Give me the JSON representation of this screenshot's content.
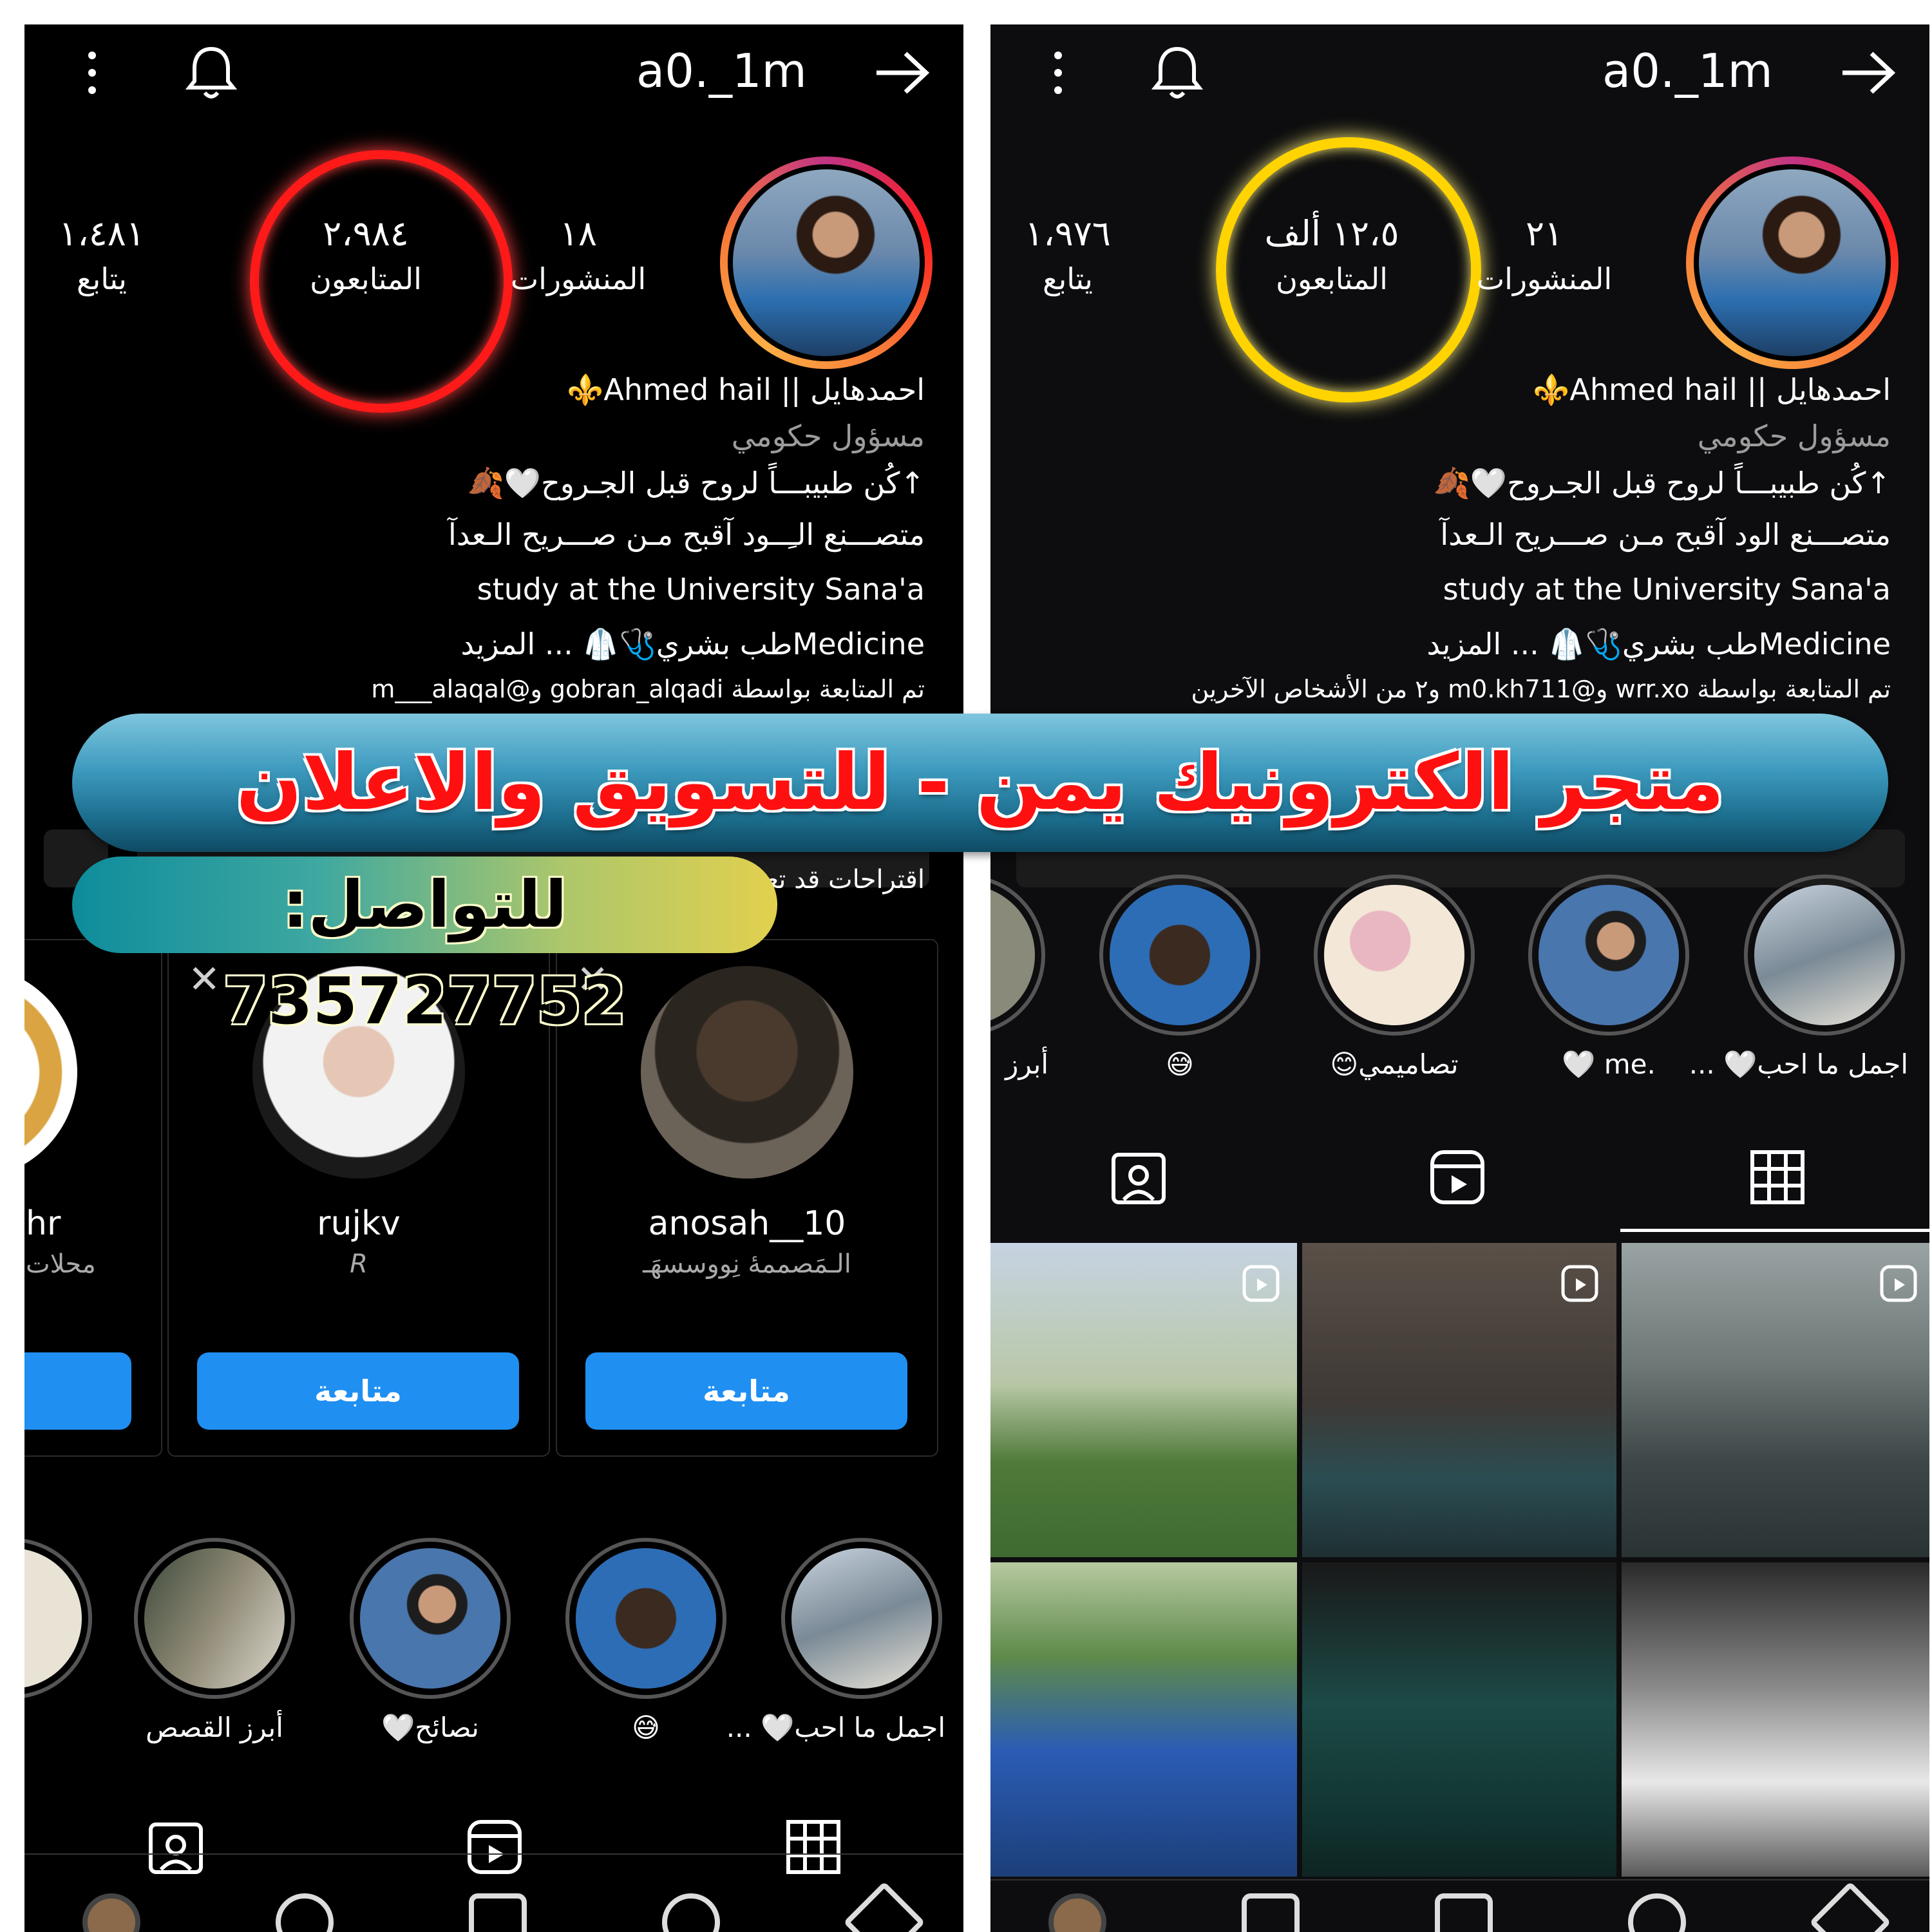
{
  "left": {
    "username": "a0._1m",
    "stats": {
      "posts": {
        "value": "١٨",
        "label": "المنشورات"
      },
      "followers": {
        "value": "٢،٩٨٤",
        "label": "المتابعون"
      },
      "following": {
        "value": "١،٤٨١",
        "label": "يتابع"
      }
    },
    "bio": {
      "name": "احمدهايل || Ahmed hail⚜️",
      "category": "مسؤول حكومي",
      "line1": "↑كُن طبيبـــاً لروح قبل الجـروح🤍🍂",
      "line2": "متصـــنع الـِــود آقبح مـن صـــريح الـعدآ",
      "line3": "study at the University Sana'a",
      "line4": "Medicineطب بشري🩺🥼 ... المزيد",
      "followed_by": "تم المتابعة بواسطة gobran_alqadi و@m___alaqal"
    },
    "suggestions_label": "اقتراحات قد تعجبك",
    "suggestions": [
      {
        "name": "anosah__10",
        "sub": "الـمَصممهٔ نِووسسهَـ",
        "button": "متابعة"
      },
      {
        "name": "rujkv",
        "sub": "R",
        "button": "متابعة"
      },
      {
        "name": "hr",
        "sub": "محلات",
        "button": ""
      }
    ],
    "stories": [
      {
        "label": "اجمل ما احب🤍 ..."
      },
      {
        "label": "😅"
      },
      {
        "label": "نصائح🤍"
      },
      {
        "label": "أبرز القصص"
      }
    ]
  },
  "right": {
    "username": "a0._1m",
    "stats": {
      "posts": {
        "value": "٢١",
        "label": "المنشورات"
      },
      "followers": {
        "value": "١٢،٥ ألف",
        "label": "المتابعون"
      },
      "following": {
        "value": "١،٩٧٦",
        "label": "يتابع"
      }
    },
    "bio": {
      "name": "احمدهايل || Ahmed hail⚜️",
      "category": "مسؤول حكومي",
      "line1": "↑كُن طبيبـــاً لروح قبل الجـروح🤍🍂",
      "line2": "متصـــنع الود آقبح مـن صـــريح الـعدآ",
      "line3": "study at the University Sana'a",
      "line4": "Medicineطب بشري🩺🥼 ... المزيد",
      "followed_by": "تم المتابعة بواسطة wrr.xo و@m0.kh711 و٢ من الأشخاص الآخرين"
    },
    "stories": [
      {
        "label": "اجمل ما احب🤍 ..."
      },
      {
        "label": ".me 🤍"
      },
      {
        "label": "تصاميمي😊"
      },
      {
        "label": "😅"
      },
      {
        "label": "أبرز"
      }
    ]
  },
  "overlay": {
    "banner": "متجر الكترونيك يمن - للتسويق والاعلان",
    "contact": "للتواصل: 735727752"
  },
  "colors": {
    "left_highlight": "#ff1a1a",
    "right_highlight": "#ffd400",
    "follow_button": "#1f8ff2",
    "banner_text": "#ff1010"
  }
}
